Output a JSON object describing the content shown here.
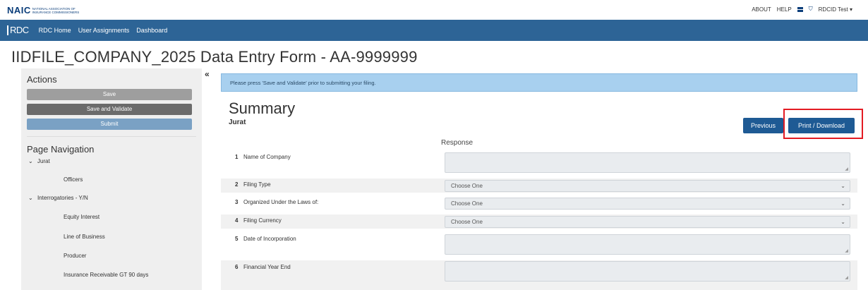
{
  "header": {
    "logo_main": "NAIC",
    "logo_sub": "NATIONAL ASSOCIATION OF INSURANCE COMMISSIONERS",
    "links": [
      "ABOUT",
      "HELP"
    ],
    "user": "RDCID Test",
    "user_caret": "▾"
  },
  "navbar": {
    "logo": "RDC",
    "items": [
      "RDC Home",
      "User Assignments",
      "Dashboard"
    ]
  },
  "page_title": "IIDFILE_COMPANY_2025 Data Entry Form - AA-9999999",
  "sidebar": {
    "actions_heading": "Actions",
    "save": "Save",
    "save_validate": "Save and Validate",
    "submit": "Submit",
    "nav_heading": "Page Navigation",
    "nav": [
      {
        "label": "Jurat",
        "expanded": true
      },
      {
        "label": "Officers",
        "expanded": false
      },
      {
        "label": "Interrogatories - Y/N",
        "expanded": true
      },
      {
        "label": "Equity Interest",
        "expanded": false
      },
      {
        "label": "Line of Business",
        "expanded": false
      },
      {
        "label": "Producer",
        "expanded": false
      },
      {
        "label": "Insurance Receivable GT 90 days",
        "expanded": false
      }
    ],
    "collapse_glyph": "«"
  },
  "alert": "Please press 'Save and Validate' prior to submitting your filing.",
  "summary": {
    "title": "Summary",
    "subtitle": "Jurat",
    "previous": "Previous",
    "print": "Print / Download",
    "response_header": "Response"
  },
  "questions": [
    {
      "num": "1",
      "label": "Name of Company",
      "type": "text",
      "value": ""
    },
    {
      "num": "2",
      "label": "Filing Type",
      "type": "select",
      "value": "Choose One"
    },
    {
      "num": "3",
      "label": "Organized Under the Laws of:",
      "type": "select",
      "value": "Choose One"
    },
    {
      "num": "4",
      "label": "Filing Currency",
      "type": "select",
      "value": "Choose One"
    },
    {
      "num": "5",
      "label": "Date of Incorporation",
      "type": "text",
      "value": ""
    },
    {
      "num": "6",
      "label": "Financial Year End",
      "type": "text",
      "value": ""
    }
  ],
  "colors": {
    "navbar": "#2d6496",
    "primary_button": "#1e5a94",
    "alert_bg": "#a8d0ef",
    "highlight": "#e31b23"
  }
}
